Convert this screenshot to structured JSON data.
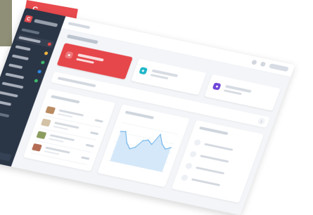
{
  "brand": {
    "logo_glyph": "C",
    "accent": "#e84a4e"
  },
  "colors": {
    "sidebar": "#2a3546",
    "card_primary": "#e6474b",
    "status_red": "#e34b4f",
    "status_yellow": "#f1b53f",
    "status_green": "#3fb86c",
    "status_blue": "#2d8ae6",
    "status_teal": "#1fb7c8",
    "status_purple": "#7046d8",
    "chart_fill": "#cfe6f8",
    "chart_line": "#6db2ea"
  },
  "icons": {
    "logo": "brand-logo-icon",
    "search": "search-icon",
    "bell": "bell-icon",
    "user": "user-icon",
    "arrow": "chevron-right-icon",
    "bag": "shopping-bag-icon",
    "chart": "chart-icon",
    "message": "message-icon"
  },
  "chart_data": {
    "type": "area",
    "series": [
      {
        "values": [
          35,
          36,
          24,
          18,
          21,
          30,
          32,
          28,
          41,
          31,
          26,
          29
        ]
      }
    ]
  }
}
